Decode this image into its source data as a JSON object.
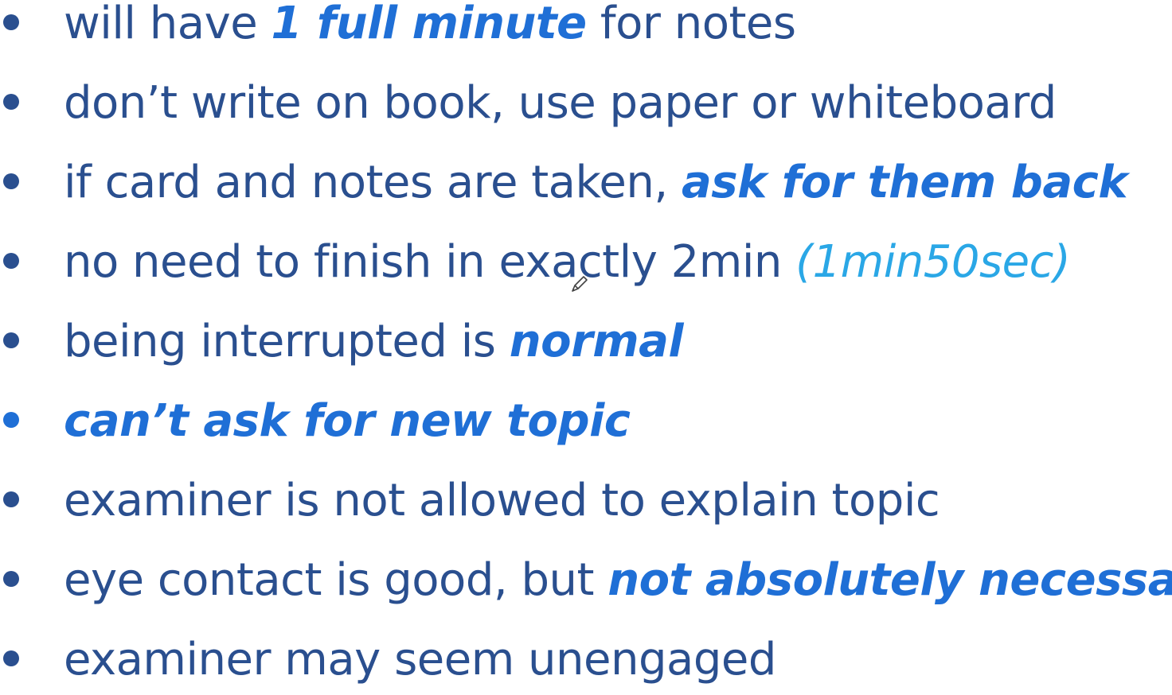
{
  "slide": {
    "colors": {
      "text": "#2a4f8f",
      "accent": "#1f6fd6",
      "light_accent": "#2aa7e6"
    },
    "bullets": [
      {
        "segments": [
          {
            "text": "will have ",
            "style": "plain"
          },
          {
            "text": "1 full minute",
            "style": "accent"
          },
          {
            "text": " for notes",
            "style": "plain"
          }
        ]
      },
      {
        "segments": [
          {
            "text": "don’t write on book, use paper or whiteboard",
            "style": "plain"
          }
        ]
      },
      {
        "segments": [
          {
            "text": "if card and notes are taken, ",
            "style": "plain"
          },
          {
            "text": "ask for them back",
            "style": "accent"
          }
        ]
      },
      {
        "segments": [
          {
            "text": "no need to finish in exactly 2min ",
            "style": "plain"
          },
          {
            "text": "(1min50sec)",
            "style": "light"
          }
        ]
      },
      {
        "segments": [
          {
            "text": "being interrupted is ",
            "style": "plain"
          },
          {
            "text": "normal",
            "style": "accent"
          }
        ]
      },
      {
        "segments": [
          {
            "text": "can’t ask for new topic",
            "style": "accent"
          }
        ]
      },
      {
        "segments": [
          {
            "text": "examiner is not allowed to explain topic",
            "style": "plain"
          }
        ]
      },
      {
        "segments": [
          {
            "text": "eye contact is good, but ",
            "style": "plain"
          },
          {
            "text": "not absolutely necessary",
            "style": "accent"
          }
        ]
      },
      {
        "segments": [
          {
            "text": "examiner may seem unengaged",
            "style": "plain"
          }
        ]
      }
    ],
    "cursor_icon": "pen-cursor-icon"
  }
}
